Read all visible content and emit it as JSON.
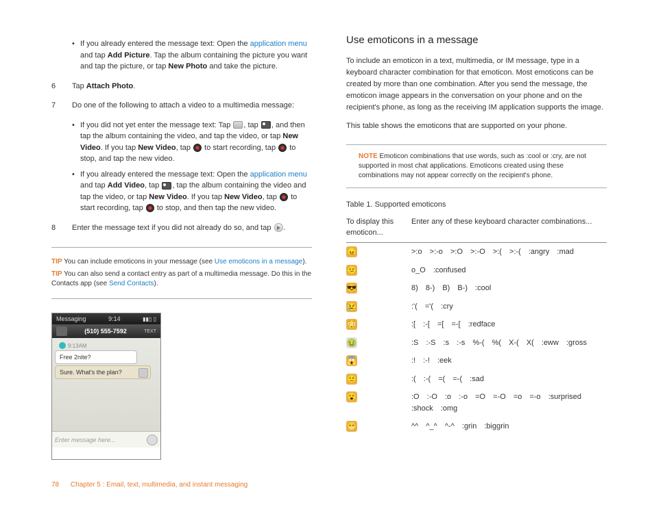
{
  "left": {
    "bullet1_prefix": "If you already entered the message text: Open the ",
    "bullet1_link": "application menu",
    "bullet1_mid1": " and tap ",
    "bullet1_bold1": "Add Picture",
    "bullet1_mid2": ". Tap the album containing the picture you want and tap the picture, or tap ",
    "bullet1_bold2": "New Photo",
    "bullet1_end": " and take the picture.",
    "step6_num": "6",
    "step6_pre": "Tap ",
    "step6_bold": "Attach Photo",
    "step6_end": ".",
    "step7_num": "7",
    "step7_text": "Do one of the following to attach a video to a multimedia message:",
    "b7a_pre": "If you did not yet enter the message text: Tap ",
    "b7a_mid1": ", tap ",
    "b7a_mid2": ", and then tap the album containing the video, and tap the video, or tap ",
    "b7a_bold1": "New Video",
    "b7a_mid3": ". If you tap ",
    "b7a_bold2": "New Video",
    "b7a_mid4": ", tap ",
    "b7a_mid5": " to start recording, tap ",
    "b7a_mid6": " to stop, and tap the new video.",
    "b7b_pre": "If you already entered the message text: Open the ",
    "b7b_link": "application menu",
    "b7b_mid1": " and tap ",
    "b7b_bold1": "Add Video",
    "b7b_mid2": ", tap ",
    "b7b_mid3": ", tap the album containing the video and tap the video, or tap ",
    "b7b_bold2": "New Video",
    "b7b_mid4": ". If you tap ",
    "b7b_bold3": "New Video",
    "b7b_mid5": ", tap ",
    "b7b_mid6": " to start recording, tap ",
    "b7b_mid7": " to stop, and then tap the new video.",
    "step8_num": "8",
    "step8_text": "Enter the message text if you did not already do so, and tap ",
    "step8_end": ".",
    "tip1_label": "TIP",
    "tip1_pre": " You can include emoticons in your message (see ",
    "tip1_link": "Use emoticons in a message",
    "tip1_end": ").",
    "tip2_label": "TIP",
    "tip2_pre": " You can also send a contact entry as part of a multimedia message. Do this in the Contacts app (see ",
    "tip2_link": "Send Contacts",
    "tip2_end": ")."
  },
  "phone": {
    "status_app": "Messaging",
    "status_time": "9:14",
    "header_num": "(510) 555-7592",
    "header_btn": "TEXT",
    "timestamp": "9:13AM",
    "msg_in": "Free 2nite?",
    "msg_out": "Sure. What's the plan?",
    "input_placeholder": "Enter message here..."
  },
  "right": {
    "title": "Use emoticons in a message",
    "p1": "To include an emoticon in a text, multimedia, or IM message, type in a keyboard character combination for that emoticon. Most emoticons can be created by more than one combination. After you send the message, the emoticon image appears in the conversation on your phone and on the recipient's phone, as long as the receiving IM application supports the image.",
    "p2": "This table shows the emoticons that are supported on your phone.",
    "note_label": "NOTE",
    "note_text": " Emoticon combinations that use words, such as :cool or :cry, are not supported in most chat applications. Emoticons created using these combinations may not appear correctly on the recipient's phone.",
    "table_caption": "Table 1.  Supported emoticons",
    "th1": "To display this emoticon...",
    "th2": "Enter any of these keyboard character combinations...",
    "rows": [
      {
        "face": "😠",
        "bg": "#e8b14a",
        "combos": ">:o >:-o >:O >:-O >:( >:-( :angry :mad"
      },
      {
        "face": "😕",
        "bg": "#e8b14a",
        "combos": "o_O :confused"
      },
      {
        "face": "😎",
        "bg": "#e8b14a",
        "combos": "8) 8-) B) B-) :cool"
      },
      {
        "face": "😢",
        "bg": "#e8b14a",
        "combos": ":'( ='( :cry"
      },
      {
        "face": "😳",
        "bg": "#e8b14a",
        "combos": ":[ :-[ =[ =-[ :redface"
      },
      {
        "face": "🤢",
        "bg": "#e0e0e0",
        "combos": ":S :-S :s :-s %-( %( X-( X( :eww :gross"
      },
      {
        "face": "😱",
        "bg": "#e8b14a",
        "combos": ":! :-! :eek"
      },
      {
        "face": "🙁",
        "bg": "#e8b14a",
        "combos": ":( :-( =( =-( :sad"
      },
      {
        "face": "😮",
        "bg": "#e8b14a",
        "combos": ":O :-O :o :-o =O =-O =o =-o :surprised :shock :omg"
      },
      {
        "face": "😁",
        "bg": "#e8b14a",
        "combos": "^^ ^_^ ^-^ :grin :biggrin"
      }
    ]
  },
  "footer": {
    "page": "78",
    "chapter": "Chapter 5 : Email, text, multimedia, and instant messaging"
  }
}
